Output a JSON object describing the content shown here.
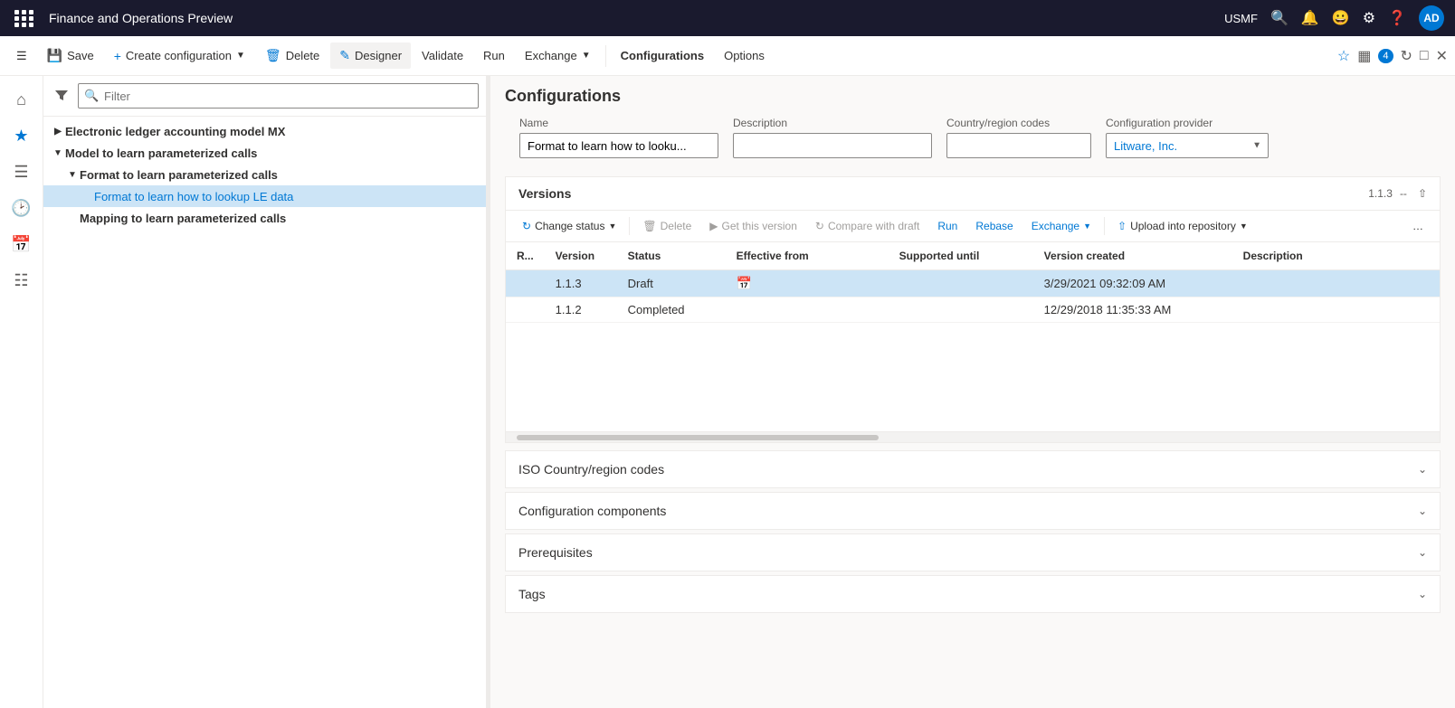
{
  "app": {
    "title": "Finance and Operations Preview",
    "user": "USMF",
    "avatar": "AD"
  },
  "toolbar": {
    "save_label": "Save",
    "create_label": "Create configuration",
    "delete_label": "Delete",
    "designer_label": "Designer",
    "validate_label": "Validate",
    "run_label": "Run",
    "exchange_label": "Exchange",
    "configurations_label": "Configurations",
    "options_label": "Options"
  },
  "filter": {
    "placeholder": "Filter"
  },
  "tree": {
    "items": [
      {
        "id": "item-1",
        "label": "Electronic ledger accounting model MX",
        "level": 0,
        "expanded": false,
        "selected": false
      },
      {
        "id": "item-2",
        "label": "Model to learn parameterized calls",
        "level": 0,
        "expanded": true,
        "selected": false
      },
      {
        "id": "item-3",
        "label": "Format to learn parameterized calls",
        "level": 1,
        "expanded": true,
        "selected": false
      },
      {
        "id": "item-4",
        "label": "Format to learn how to lookup LE data",
        "level": 2,
        "expanded": false,
        "selected": true
      },
      {
        "id": "item-5",
        "label": "Mapping to learn parameterized calls",
        "level": 1,
        "expanded": false,
        "selected": false
      }
    ]
  },
  "content": {
    "title": "Configurations",
    "form": {
      "name_label": "Name",
      "name_value": "Format to learn how to looku...",
      "description_label": "Description",
      "description_value": "",
      "country_label": "Country/region codes",
      "country_value": "",
      "provider_label": "Configuration provider",
      "provider_value": "Litware, Inc."
    },
    "versions": {
      "title": "Versions",
      "version_number": "1.1.3",
      "separator": "--",
      "toolbar": {
        "change_status": "Change status",
        "delete": "Delete",
        "get_this_version": "Get this version",
        "compare_with_draft": "Compare with draft",
        "run": "Run",
        "rebase": "Rebase",
        "exchange": "Exchange",
        "upload_into_repository": "Upload into repository"
      },
      "table": {
        "columns": [
          "R...",
          "Version",
          "Status",
          "Effective from",
          "Supported until",
          "Version created",
          "Description"
        ],
        "rows": [
          {
            "r": "",
            "version": "1.1.3",
            "status": "Draft",
            "effective_from": "",
            "supported_until": "",
            "version_created": "3/29/2021 09:32:09 AM",
            "description": "",
            "selected": true
          },
          {
            "r": "",
            "version": "1.1.2",
            "status": "Completed",
            "effective_from": "",
            "supported_until": "",
            "version_created": "12/29/2018 11:35:33 AM",
            "description": "",
            "selected": false
          }
        ]
      }
    },
    "collapsed_sections": [
      {
        "id": "iso",
        "title": "ISO Country/region codes"
      },
      {
        "id": "components",
        "title": "Configuration components"
      },
      {
        "id": "prerequisites",
        "title": "Prerequisites"
      },
      {
        "id": "tags",
        "title": "Tags"
      }
    ]
  }
}
